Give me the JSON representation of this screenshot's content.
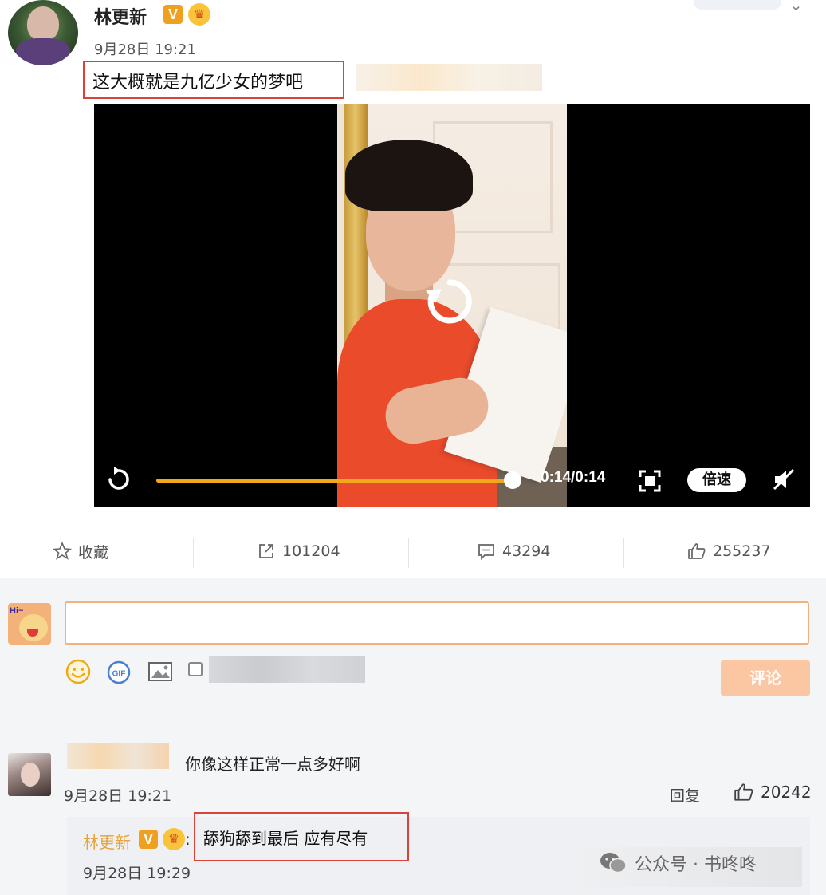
{
  "post": {
    "author": "林更新",
    "badge_v": "V",
    "date": "9月28日 19:21",
    "text": "这大概就是九亿少女的梦吧"
  },
  "video": {
    "timecode": "0:14/0:14",
    "progress": 1.0,
    "speed_label": "倍速"
  },
  "actions": {
    "favorite_label": "收藏",
    "repost_count": "101204",
    "comment_count": "43294",
    "like_count": "255237"
  },
  "composer": {
    "avatar_text": "Hi~",
    "gif_label": "GIF",
    "submit_label": "评论"
  },
  "comment": {
    "text": "你像这样正常一点多好啊",
    "date": "9月28日 19:21",
    "reply_label": "回复",
    "like_count": "20242",
    "reply": {
      "author": "林更新",
      "badge_v": "V",
      "colon": ":",
      "text": "舔狗舔到最后 应有尽有",
      "date": "9月28日 19:29"
    }
  },
  "watermark": {
    "text": "公众号 · 书咚咚"
  },
  "colors": {
    "accent_orange": "#f2a81d",
    "highlight_red": "#d9433a",
    "submit_bg": "#fbc6a2",
    "reply_author": "#e8a23a"
  }
}
